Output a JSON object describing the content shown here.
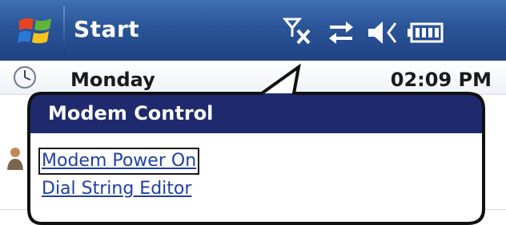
{
  "taskbar": {
    "start_label": "Start",
    "icons": [
      "windows-logo-icon",
      "no-signal-antenna-icon",
      "connectivity-arrows-icon",
      "speaker-muted-icon",
      "battery-icon"
    ]
  },
  "today": {
    "day": "Monday",
    "time": "02:09 PM"
  },
  "bubble": {
    "title": "Modem Control",
    "header_color": "#1f2a6e",
    "links": [
      {
        "label": "Modem Power On",
        "focused": true
      },
      {
        "label": "Dial String Editor",
        "focused": false
      }
    ]
  },
  "colors": {
    "taskbar": "#2b5498",
    "link": "#1f3fa8",
    "bubble_border": "#111111"
  }
}
